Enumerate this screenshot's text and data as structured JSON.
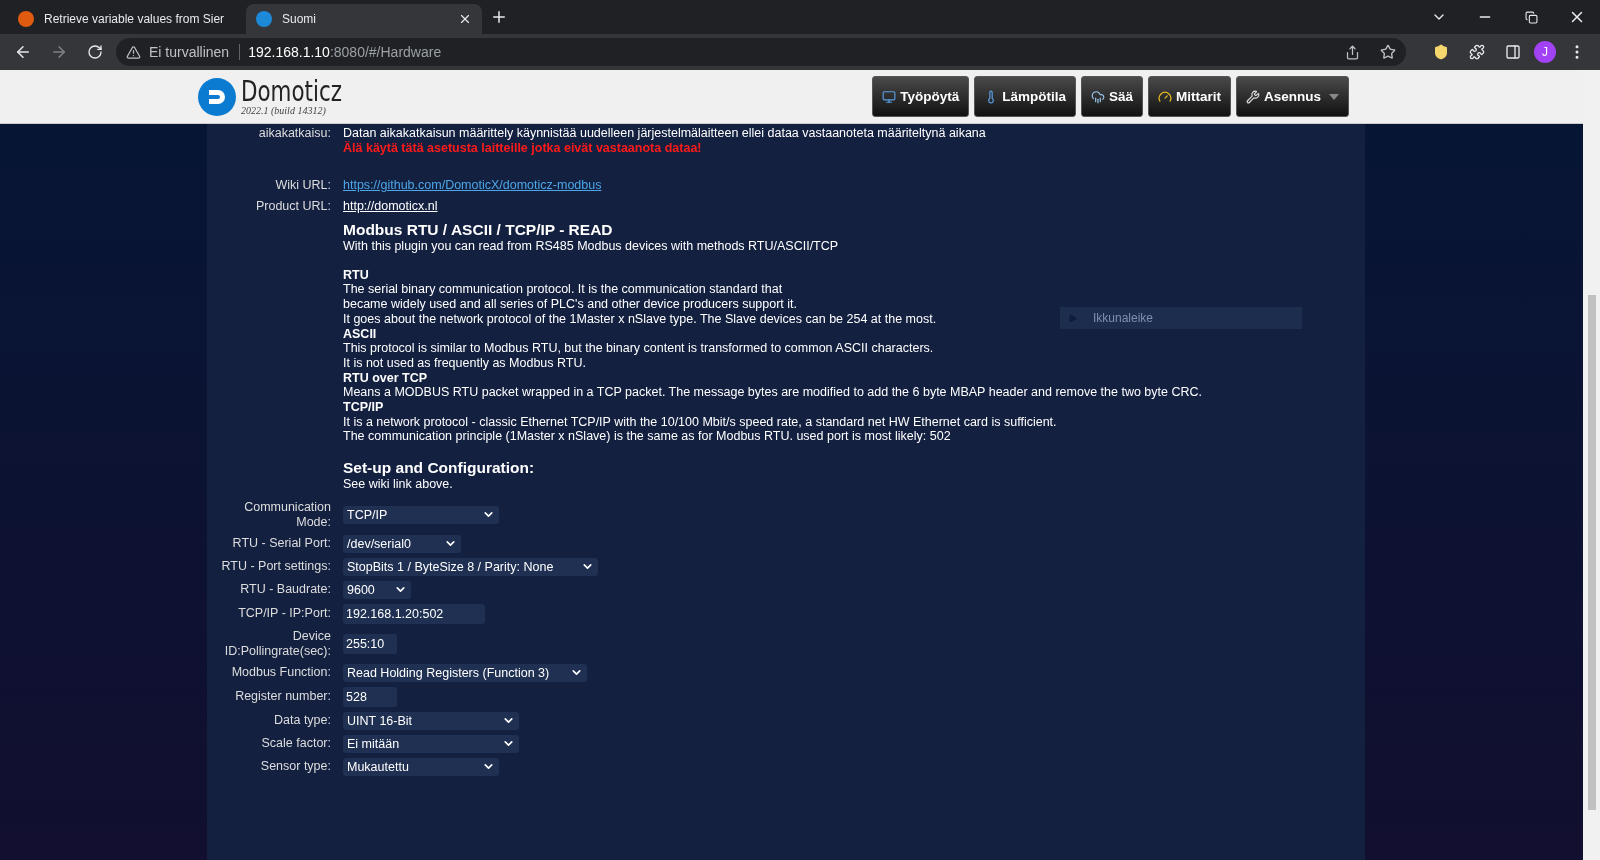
{
  "browser": {
    "tabs": [
      {
        "title": "Retrieve variable values from Sier",
        "selected": false
      },
      {
        "title": "Suomi",
        "selected": true
      }
    ],
    "security": "Ei turvallinen",
    "url_host": "192.168.1.10",
    "url_rest": ":8080/#/Hardware",
    "avatar": "J"
  },
  "header": {
    "logo": "Domoticz",
    "version": "2022.1 (build 14312)",
    "nav": [
      {
        "label": "Työpöytä",
        "dropdown": false
      },
      {
        "label": "Lämpötila",
        "dropdown": false
      },
      {
        "label": "Sää",
        "dropdown": false
      },
      {
        "label": "Mittarit",
        "dropdown": false
      },
      {
        "label": "Asennus",
        "dropdown": true
      }
    ]
  },
  "timeout": {
    "label": "aikakatkaisu:",
    "text": "Datan aikakatkaisun määrittely käynnistää uudelleen järjestelmälaitteen ellei dataa vastaanoteta määriteltynä aikana",
    "warning": "Älä käytä tätä asetusta laitteille jotka eivät vastaanota dataa!"
  },
  "links": [
    {
      "label": "Wiki URL:",
      "url": "https://github.com/DomoticX/domoticz-modbus",
      "kind": "blue"
    },
    {
      "label": "Product URL:",
      "url": "http://domoticx.nl",
      "kind": "white"
    }
  ],
  "description": [
    {
      "kind": "title",
      "text": "Modbus RTU / ASCII / TCP/IP - READ"
    },
    {
      "kind": "line",
      "text": "With this plugin you can read from RS485 Modbus devices with methods RTU/ASCII/TCP"
    },
    {
      "kind": "gap"
    },
    {
      "kind": "subhead",
      "text": "RTU"
    },
    {
      "kind": "line",
      "text": "The serial binary communication protocol. It is the communication standard that"
    },
    {
      "kind": "line",
      "text": "became widely used and all series of PLC's and other device producers support it."
    },
    {
      "kind": "line",
      "text": "It goes about the network protocol of the 1Master x nSlave type. The Slave devices can be 254 at the most."
    },
    {
      "kind": "subhead",
      "text": "ASCII"
    },
    {
      "kind": "line",
      "text": "This protocol is similar to Modbus RTU, but the binary content is transformed to common ASCII characters."
    },
    {
      "kind": "line",
      "text": "It is not used as frequently as Modbus RTU."
    },
    {
      "kind": "subhead",
      "text": "RTU over TCP"
    },
    {
      "kind": "line",
      "text": "Means a MODBUS RTU packet wrapped in a TCP packet. The message bytes are modified to add the 6 byte MBAP header and remove the two byte CRC."
    },
    {
      "kind": "subhead",
      "text": "TCP/IP"
    },
    {
      "kind": "line",
      "text": "It is a network protocol - classic Ethernet TCP/IP with the 10/100 Mbit/s speed rate, a standard net HW Ethernet card is sufficient."
    },
    {
      "kind": "line",
      "text": "The communication principle (1Master x nSlave) is the same as for Modbus RTU. used port is most likely: 502"
    },
    {
      "kind": "gap"
    },
    {
      "kind": "title",
      "text": "Set-up and Configuration:"
    },
    {
      "kind": "line",
      "text": "See wiki link above."
    }
  ],
  "fields": [
    {
      "label": "Communication Mode:",
      "kind": "select",
      "value": "TCP/IP"
    },
    {
      "label": "RTU - Serial Port:",
      "kind": "select",
      "value": "/dev/serial0"
    },
    {
      "label": "RTU - Port settings:",
      "kind": "select",
      "value": "StopBits 1 / ByteSize 8 / Parity: None"
    },
    {
      "label": "RTU - Baudrate:",
      "kind": "select",
      "value": "9600"
    },
    {
      "label": "TCP/IP - IP:Port:",
      "kind": "input",
      "value": "192.168.1.20:502"
    },
    {
      "label": "Device ID:Pollingrate(sec):",
      "kind": "input",
      "value": "255:10"
    },
    {
      "label": "Modbus Function:",
      "kind": "select",
      "value": "Read Holding Registers (Function 3)"
    },
    {
      "label": "Register number:",
      "kind": "input",
      "value": "528"
    },
    {
      "label": "Data type:",
      "kind": "select",
      "value": "UINT 16-Bit"
    },
    {
      "label": "Scale factor:",
      "kind": "select",
      "value": "Ei mitään"
    },
    {
      "label": "Sensor type:",
      "kind": "select",
      "value": "Mukautettu"
    }
  ],
  "overlay": {
    "label": "Ikkunaleike"
  }
}
